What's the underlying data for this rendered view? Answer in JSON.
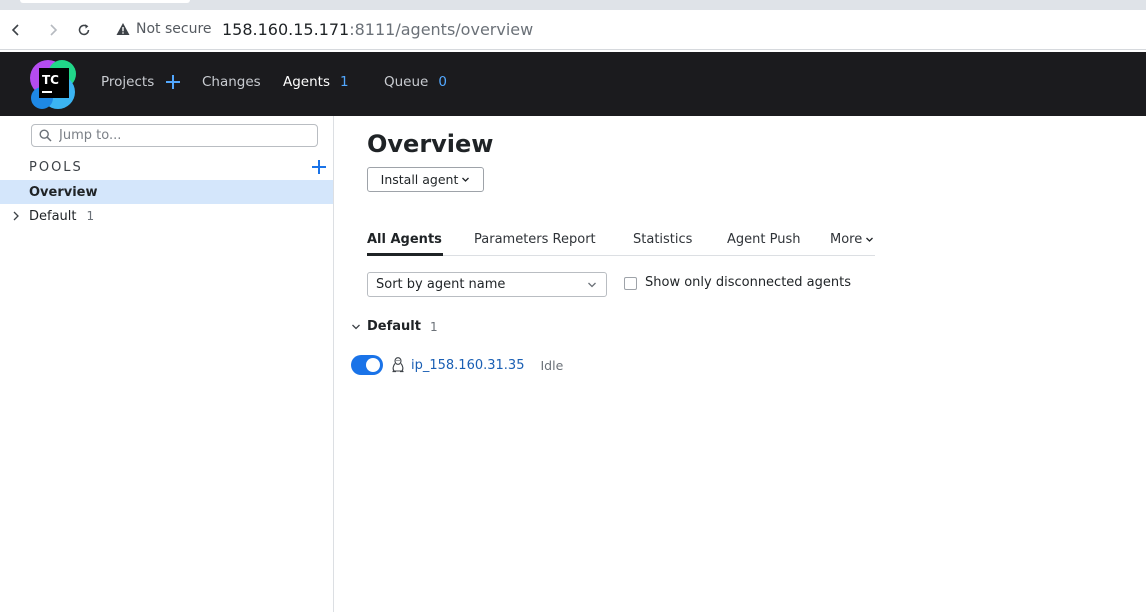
{
  "browser": {
    "security_label": "Not secure",
    "url_host": "158.160.15.171",
    "url_rest": ":8111/agents/overview"
  },
  "header": {
    "logo_text": "TC",
    "nav": {
      "projects": "Projects",
      "changes": "Changes",
      "agents": "Agents",
      "agents_count": "1",
      "queue": "Queue",
      "queue_count": "0"
    }
  },
  "sidebar": {
    "search_placeholder": "Jump to...",
    "pools_title": "POOLS",
    "items": [
      {
        "label": "Overview",
        "selected": true
      },
      {
        "label": "Default",
        "count": "1"
      }
    ]
  },
  "main": {
    "title": "Overview",
    "install_button": "Install agent",
    "tabs": [
      {
        "label": "All Agents",
        "active": true
      },
      {
        "label": "Parameters Report"
      },
      {
        "label": "Statistics"
      },
      {
        "label": "Agent Push"
      },
      {
        "label": "More"
      }
    ],
    "sort_select": "Sort by agent name",
    "disconnected_checkbox_label": "Show only disconnected agents",
    "groups": [
      {
        "name": "Default",
        "count": "1",
        "agents": [
          {
            "name": "ip_158.160.31.35",
            "status": "Idle",
            "enabled": true,
            "os_icon": "linux-icon"
          }
        ]
      }
    ]
  },
  "colors": {
    "header_bg": "#1b1b1e",
    "accent_blue": "#1a73e8",
    "selection_bg": "#d4e6fb",
    "count_blue": "#52a8ff"
  }
}
